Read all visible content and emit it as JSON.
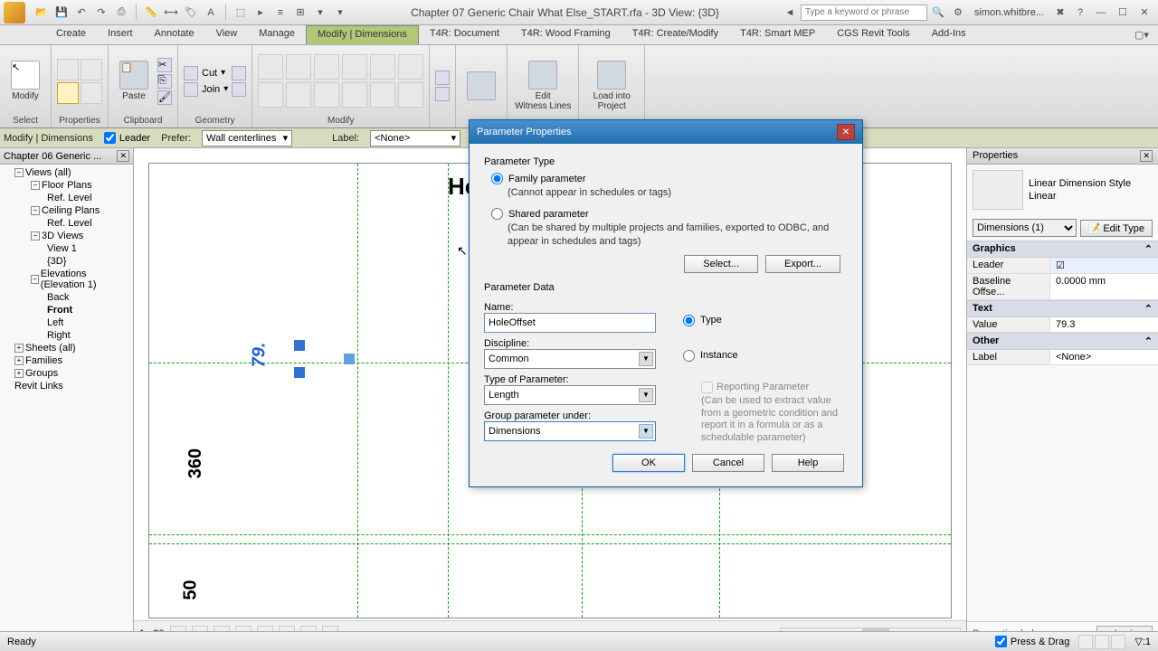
{
  "title": "Chapter 07 Generic Chair What Else_START.rfa - 3D View: {3D}",
  "user": "simon.whitbre...",
  "search_placeholder": "Type a keyword or phrase",
  "ribbon_tabs": [
    "Create",
    "Insert",
    "Annotate",
    "View",
    "Manage",
    "Modify | Dimensions",
    "T4R: Document",
    "T4R: Wood Framing",
    "T4R: Create/Modify",
    "T4R: Smart MEP",
    "CGS Revit Tools",
    "Add-Ins"
  ],
  "ribbon_active_index": 5,
  "panels": {
    "select": "Select",
    "properties": "Properties",
    "clipboard": "Clipboard",
    "geometry": "Geometry",
    "modify": "Modify",
    "modify_btn": "Modify",
    "paste": "Paste",
    "cut": "Cut",
    "join": "Join",
    "edit_witness": "Edit\nWitness Lines",
    "load_project": "Load into\nProject"
  },
  "options_bar": {
    "context": "Modify | Dimensions",
    "leader_label": "Leader",
    "leader_checked": true,
    "prefer_label": "Prefer:",
    "prefer_value": "Wall centerlines",
    "label_label": "Label:",
    "label_value": "<None>"
  },
  "browser": {
    "title": "Chapter 06 Generic ...",
    "tree": [
      {
        "lvl": 0,
        "exp": "-",
        "text": "Views (all)"
      },
      {
        "lvl": 1,
        "exp": "-",
        "text": "Floor Plans"
      },
      {
        "lvl": 2,
        "text": "Ref. Level"
      },
      {
        "lvl": 1,
        "exp": "-",
        "text": "Ceiling Plans"
      },
      {
        "lvl": 2,
        "text": "Ref. Level"
      },
      {
        "lvl": 1,
        "exp": "-",
        "text": "3D Views"
      },
      {
        "lvl": 2,
        "text": "View 1"
      },
      {
        "lvl": 2,
        "text": "{3D}"
      },
      {
        "lvl": 1,
        "exp": "-",
        "text": "Elevations (Elevation 1)"
      },
      {
        "lvl": 2,
        "text": "Back"
      },
      {
        "lvl": 2,
        "text": "Front",
        "bold": true
      },
      {
        "lvl": 2,
        "text": "Left"
      },
      {
        "lvl": 2,
        "text": "Right"
      },
      {
        "lvl": 0,
        "exp": "+",
        "text": "Sheets (all)"
      },
      {
        "lvl": 0,
        "exp": "+",
        "text": "Families"
      },
      {
        "lvl": 0,
        "exp": "+",
        "text": "Groups"
      },
      {
        "lvl": 0,
        "text": "Revit Links"
      }
    ]
  },
  "view": {
    "scale": "1 : 20",
    "dim_blue": "79.",
    "dim_black1": "360",
    "dim_black2": "50",
    "partial_text": "Ho"
  },
  "props": {
    "title": "Properties",
    "type_name": "Linear Dimension Style\nLinear",
    "selector": "Dimensions (1)",
    "edit_type": "Edit Type",
    "groups": {
      "graphics": "Graphics",
      "text": "Text",
      "other": "Other"
    },
    "rows": {
      "leader_k": "Leader",
      "leader_v": "✓",
      "baseline_k": "Baseline Offse...",
      "baseline_v": "0.0000 mm",
      "value_k": "Value",
      "value_v": "79.3",
      "label_k": "Label",
      "label_v": "<None>"
    },
    "help": "Properties help",
    "apply": "Apply"
  },
  "dialog": {
    "title": "Parameter Properties",
    "section1": "Parameter Type",
    "family_param": "Family parameter",
    "family_help": "(Cannot appear in schedules or tags)",
    "shared_param": "Shared parameter",
    "shared_help": "(Can be shared by multiple projects and families, exported to ODBC, and appear in schedules and tags)",
    "select_btn": "Select...",
    "export_btn": "Export...",
    "section2": "Parameter Data",
    "name_label": "Name:",
    "name_value": "HoleOffset",
    "discipline_label": "Discipline:",
    "discipline_value": "Common",
    "typeof_label": "Type of Parameter:",
    "typeof_value": "Length",
    "group_label": "Group parameter under:",
    "group_value": "Dimensions",
    "type_radio": "Type",
    "instance_radio": "Instance",
    "reporting_label": "Reporting Parameter",
    "reporting_help": "(Can be used to extract value from a geometric condition and report it in a formula or as a schedulable parameter)",
    "ok": "OK",
    "cancel": "Cancel",
    "help": "Help"
  },
  "status": {
    "ready": "Ready",
    "press_drag": "Press & Drag",
    "filter_count": ":1"
  }
}
